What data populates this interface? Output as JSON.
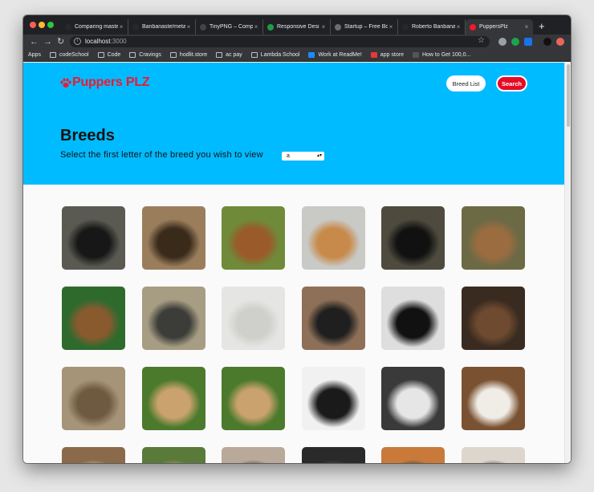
{
  "browser": {
    "tabs": [
      {
        "title": "Comparing maste",
        "fav_color": "#24292e",
        "active": false
      },
      {
        "title": "Banbanaste/meta",
        "fav_color": "#24292e",
        "active": false
      },
      {
        "title": "TinyPNG – Comp",
        "fav_color": "#444444",
        "active": false
      },
      {
        "title": "Responsive Desi",
        "fav_color": "#1e9c4a",
        "active": false
      },
      {
        "title": "Startup – Free Bo",
        "fav_color": "#6d6d6d",
        "active": false
      },
      {
        "title": "Roberto Banbana",
        "fav_color": "#24292e",
        "active": false
      },
      {
        "title": "PuppersPlz",
        "fav_color": "#f0182f",
        "active": true
      }
    ],
    "close_glyph": "×",
    "new_tab_glyph": "+",
    "url_host": "localhost",
    "url_port": ":3000",
    "bookmarks": [
      {
        "label": "Apps",
        "icon": "apps-grid-icon"
      },
      {
        "label": "codeSchool",
        "icon": "folder-icon"
      },
      {
        "label": "Code",
        "icon": "folder-icon"
      },
      {
        "label": "Cravings",
        "icon": "folder-icon"
      },
      {
        "label": "hodlit.store",
        "icon": "folder-icon"
      },
      {
        "label": "ac pay",
        "icon": "folder-icon"
      },
      {
        "label": "Lambda School",
        "icon": "folder-icon"
      },
      {
        "label": "Work at ReadMe!",
        "icon": "readme-icon"
      },
      {
        "label": "app store",
        "icon": "appstore-icon"
      },
      {
        "label": "How to Get 100,0...",
        "icon": "page-icon"
      }
    ]
  },
  "site": {
    "logo": "Puppers PLZ",
    "nav": {
      "breed_list": "Breed List",
      "search": "Search"
    },
    "heading": "Breeds",
    "instruction": "Select the first letter of the breed you wish to view",
    "selected_letter": "a",
    "brand_color": "#f0182f",
    "hero_color": "#00bbff"
  },
  "gallery": {
    "images": [
      {
        "alt": "affenpinscher-photo",
        "bg": "#5a5a52",
        "fg": "#171717"
      },
      {
        "alt": "african-wild-dog-photo",
        "bg": "#9a7e5c",
        "fg": "#3a2a1a"
      },
      {
        "alt": "airedale-terrier-photo",
        "bg": "#6f8b3a",
        "fg": "#9a5a2a"
      },
      {
        "alt": "akita-photo",
        "bg": "#c9c9c6",
        "fg": "#c78a4a"
      },
      {
        "alt": "appenzeller-puppies-photo",
        "bg": "#4e4a3e",
        "fg": "#111111"
      },
      {
        "alt": "australian-dingo-photo",
        "bg": "#6b6a45",
        "fg": "#9b6c40"
      },
      {
        "alt": "beagle-photo",
        "bg": "#2f6a2d",
        "fg": "#8a5a2f"
      },
      {
        "alt": "pointer-photo",
        "bg": "#a79d83",
        "fg": "#3c3d39"
      },
      {
        "alt": "borzoi-photo",
        "bg": "#e5e5e3",
        "fg": "#cfcfcb"
      },
      {
        "alt": "bouvier-photo",
        "bg": "#8e7058",
        "fg": "#1f1f1f"
      },
      {
        "alt": "black-dog-closeup-photo",
        "bg": "#dedede",
        "fg": "#111111"
      },
      {
        "alt": "brabancon-puppy-photo",
        "bg": "#3a2b20",
        "fg": "#6e4a30"
      },
      {
        "alt": "briard-photo",
        "bg": "#a69478",
        "fg": "#6e5a40"
      },
      {
        "alt": "chihuahua-grass-photo",
        "bg": "#4c7a2c",
        "fg": "#c9a26d"
      },
      {
        "alt": "chihuahua-grass-2-photo",
        "bg": "#4c7a2c",
        "fg": "#c9a26d"
      },
      {
        "alt": "boston-terrier-snow-photo",
        "bg": "#f1f1f1",
        "fg": "#1a1a1a"
      },
      {
        "alt": "boston-terrier-photo",
        "bg": "#3a3a3a",
        "fg": "#e6e6e6"
      },
      {
        "alt": "bulldog-leaves-photo",
        "bg": "#7a5232",
        "fg": "#f0ece6"
      },
      {
        "alt": "row4-photo-1",
        "bg": "#8a6a4a",
        "fg": "#d5c9b0"
      },
      {
        "alt": "row4-photo-2",
        "bg": "#5a7a3a",
        "fg": "#c9a26d"
      },
      {
        "alt": "row4-photo-3",
        "bg": "#b9a99a",
        "fg": "#2a2a2a"
      },
      {
        "alt": "row4-photo-4",
        "bg": "#2a2a2a",
        "fg": "#5a5a5a"
      },
      {
        "alt": "row4-photo-5",
        "bg": "#c97a3a",
        "fg": "#2a2a2a"
      },
      {
        "alt": "row4-photo-6",
        "bg": "#ddd6cc",
        "fg": "#2a2a2a"
      }
    ]
  }
}
